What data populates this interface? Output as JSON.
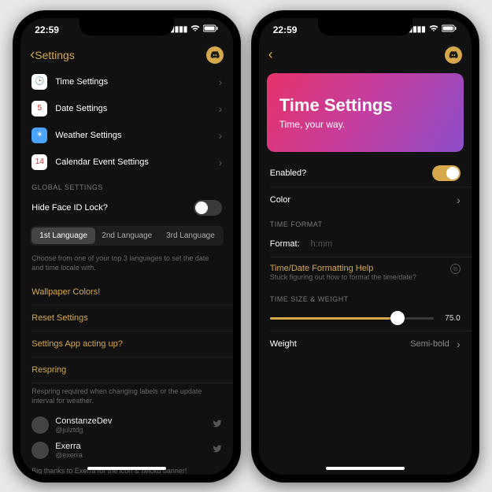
{
  "left": {
    "time": "22:59",
    "back_label": "Settings",
    "nav_items": [
      {
        "label": "Time Settings",
        "icon_bg": "#fff",
        "icon_fg": "#333",
        "emoji": "🕒"
      },
      {
        "label": "Date Settings",
        "icon_bg": "#fff",
        "icon_fg": "#d33",
        "emoji": "5"
      },
      {
        "label": "Weather Settings",
        "icon_bg": "#4aa3ff",
        "icon_fg": "#fff",
        "emoji": "☀"
      },
      {
        "label": "Calendar Event Settings",
        "icon_bg": "#fff",
        "icon_fg": "#d33",
        "emoji": "14"
      }
    ],
    "global_header": "GLOBAL SETTINGS",
    "face_id_label": "Hide Face ID Lock?",
    "segments": [
      "1st Language",
      "2nd Language",
      "3rd Language"
    ],
    "segment_active_index": 0,
    "lang_hint": "Choose from one of your top 3 languages to set the date and time locale with.",
    "actions": [
      "Wallpaper Colors!",
      "Reset Settings",
      "Settings App acting up?",
      "Respring"
    ],
    "respring_hint": "Respring required when changing labels or the update interval for weather.",
    "credits": [
      {
        "name": "ConstanzeDev",
        "handle": "@julztdg"
      },
      {
        "name": "Exerra",
        "handle": "@exerra"
      }
    ],
    "credits_footer": "Big thanks to Exerra for the icon & twickd banner!"
  },
  "right": {
    "time": "22:59",
    "hero_title": "Time Settings",
    "hero_sub": "Time, your way.",
    "enabled_label": "Enabled?",
    "color_label": "Color",
    "format_header": "TIME FORMAT",
    "format_label": "Format:",
    "format_placeholder": "h:mm",
    "help_label": "Time/Date Formatting Help",
    "help_sub": "Stuck figuring out how to format the time/date?",
    "size_header": "TIME SIZE & WEIGHT",
    "slider_value": "75.0",
    "slider_percent": 78,
    "weight_label": "Weight",
    "weight_value": "Semi-bold"
  }
}
